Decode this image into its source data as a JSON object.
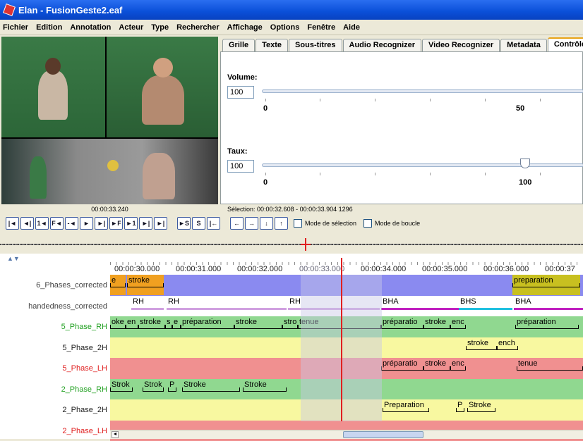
{
  "window": {
    "title": "Elan - FusionGeste2.eaf"
  },
  "menu": [
    "Fichier",
    "Edition",
    "Annotation",
    "Acteur",
    "Type",
    "Rechercher",
    "Affichage",
    "Options",
    "Fenêtre",
    "Aide"
  ],
  "tabs": [
    {
      "label": "Grille"
    },
    {
      "label": "Texte"
    },
    {
      "label": "Sous-titres"
    },
    {
      "label": "Audio Recognizer"
    },
    {
      "label": "Video Recognizer"
    },
    {
      "label": "Metadata"
    },
    {
      "label": "Contrôles",
      "active": true
    }
  ],
  "controls": {
    "volume": {
      "label": "Volume:",
      "value": "100",
      "tick_min": "0",
      "tick_mid": "50"
    },
    "rate": {
      "label": "Taux:",
      "value": "100",
      "tick_min": "0",
      "tick_mid": "100"
    }
  },
  "media": {
    "current_time": "00:00:33.240",
    "selection": "Sélection: 00:00:32.608 - 00:00:33.904  1296"
  },
  "player_buttons": [
    "|◄",
    "◄|",
    "1◄",
    "F◄",
    "-◄",
    "►",
    "►|",
    "►F",
    "►1",
    "►|",
    "►|"
  ],
  "selection_buttons": [
    "►S",
    "S",
    "|←"
  ],
  "arrow_buttons": [
    "←",
    "→",
    "↓",
    "↑"
  ],
  "checkboxes": {
    "selection_mode": "Mode de sélection",
    "loop_mode": "Mode de boucle"
  },
  "ruler": [
    "00:00:30.000",
    "00:00:31.000",
    "00:00:32.000",
    "00:00:33.000",
    "00:00:34.000",
    "00:00:35.000",
    "00:00:36.000",
    "00:00:37"
  ],
  "tiers": [
    {
      "name": "6_Phases_corrected",
      "color": "#444",
      "bg": "#8a8af0",
      "anns": [
        {
          "text": "e",
          "l": 0,
          "w": 22,
          "bg": "#f0a020"
        },
        {
          "text": "stroke",
          "l": 24,
          "w": 52,
          "bg": "#f0a020"
        },
        {
          "text": "preparation",
          "l": 570,
          "w": 96,
          "bg": "#c8c020"
        }
      ]
    },
    {
      "name": "handedness_corrected",
      "color": "#444",
      "bg": "#ffffff",
      "anns": [
        {
          "text": "RH",
          "l": 30,
          "w": 46,
          "line": "#d0a0e0"
        },
        {
          "text": "RH",
          "l": 80,
          "w": 170,
          "line": "#d0a0e0"
        },
        {
          "text": "RH",
          "l": 252,
          "w": 130,
          "line": "#d0a0e0"
        },
        {
          "text": "BHA",
          "l": 384,
          "w": 110,
          "line": "#c020c0"
        },
        {
          "text": "BHS",
          "l": 494,
          "w": 76,
          "line": "#20c0e0"
        },
        {
          "text": "BHA",
          "l": 572,
          "w": 98,
          "line": "#c020c0"
        }
      ]
    },
    {
      "name": "5_Phase_RH",
      "color": "#20a020",
      "bg": "#90d890",
      "anns": [
        {
          "text": "oke",
          "l": 0,
          "w": 22
        },
        {
          "text": "en",
          "l": 22,
          "w": 18
        },
        {
          "text": "stroke",
          "l": 40,
          "w": 38
        },
        {
          "text": "s",
          "l": 78,
          "w": 10
        },
        {
          "text": "e",
          "l": 88,
          "w": 12
        },
        {
          "text": "préparation",
          "l": 100,
          "w": 76
        },
        {
          "text": "stroke",
          "l": 176,
          "w": 68
        },
        {
          "text": "stro",
          "l": 244,
          "w": 22
        },
        {
          "text": "tenue",
          "l": 266,
          "w": 118
        },
        {
          "text": "préparatio",
          "l": 384,
          "w": 60
        },
        {
          "text": "stroke",
          "l": 444,
          "w": 38
        },
        {
          "text": "enc",
          "l": 482,
          "w": 22
        },
        {
          "text": "préparation",
          "l": 574,
          "w": 90
        }
      ]
    },
    {
      "name": "5_Phase_2H",
      "color": "#222",
      "bg": "#f8f8a0",
      "anns": [
        {
          "text": "stroke",
          "l": 504,
          "w": 44
        },
        {
          "text": "ench",
          "l": 548,
          "w": 30
        }
      ]
    },
    {
      "name": "5_Phase_LH",
      "color": "#e02020",
      "bg": "#f09090",
      "anns": [
        {
          "text": "préparatio",
          "l": 384,
          "w": 60
        },
        {
          "text": "stroke",
          "l": 444,
          "w": 38
        },
        {
          "text": "enc",
          "l": 482,
          "w": 22
        },
        {
          "text": "tenue",
          "l": 576,
          "w": 94
        }
      ]
    },
    {
      "name": "2_Phase_RH",
      "color": "#20a020",
      "bg": "#90d890",
      "anns": [
        {
          "text": "Strok",
          "l": 0,
          "w": 32
        },
        {
          "text": "Strok",
          "l": 46,
          "w": 30
        },
        {
          "text": "P",
          "l": 82,
          "w": 12
        },
        {
          "text": "Stroke",
          "l": 102,
          "w": 82
        },
        {
          "text": "Stroke",
          "l": 188,
          "w": 62
        }
      ]
    },
    {
      "name": "2_Phase_2H",
      "color": "#222",
      "bg": "#f8f8a0",
      "anns": [
        {
          "text": "Preparation",
          "l": 386,
          "w": 66
        },
        {
          "text": "P",
          "l": 490,
          "w": 12
        },
        {
          "text": "Stroke",
          "l": 506,
          "w": 40
        }
      ]
    },
    {
      "name": "2_Phase_LH",
      "color": "#e02020",
      "bg": "#f09090",
      "anns": []
    }
  ]
}
